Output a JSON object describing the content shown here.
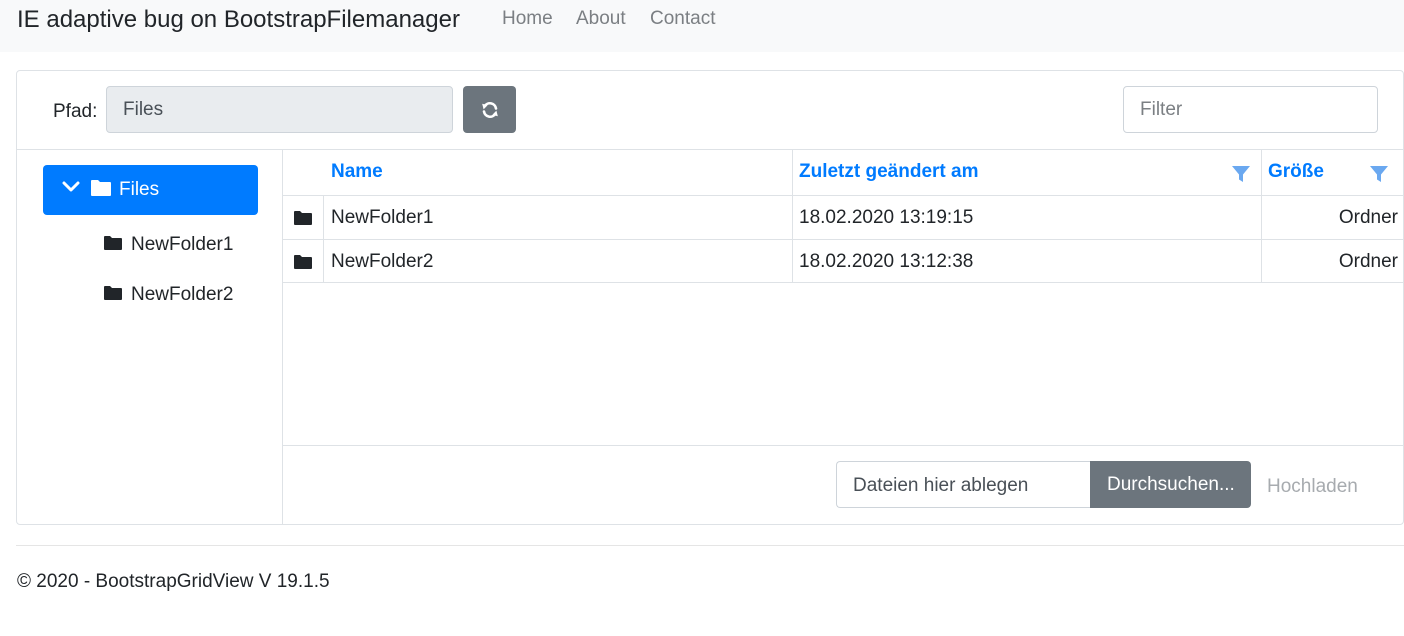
{
  "navbar": {
    "brand": "IE adaptive bug on BootstrapFilemanager",
    "links": [
      "Home",
      "About",
      "Contact"
    ]
  },
  "toolbar": {
    "path_label": "Pfad:",
    "path_value": "Files",
    "refresh_icon": "refresh-icon",
    "filter_placeholder": "Filter"
  },
  "tree": {
    "root": {
      "label": "Files",
      "icon": "folder-open-icon",
      "expanded": true
    },
    "children": [
      {
        "label": "NewFolder1",
        "icon": "folder-icon"
      },
      {
        "label": "NewFolder2",
        "icon": "folder-icon"
      }
    ]
  },
  "grid": {
    "columns": [
      "Name",
      "Zuletzt geändert am",
      "Größe"
    ],
    "rows": [
      {
        "name": "NewFolder1",
        "modified": "18.02.2020 13:19:15",
        "size": "Ordner"
      },
      {
        "name": "NewFolder2",
        "modified": "18.02.2020 13:12:38",
        "size": "Ordner"
      }
    ]
  },
  "upload": {
    "drop_text": "Dateien hier ablegen",
    "browse_label": "Durchsuchen...",
    "upload_label": "Hochladen"
  },
  "footer": {
    "text": "© 2020 - BootstrapGridView V 19.1.5"
  },
  "colors": {
    "primary": "#007bff",
    "secondary": "#6c757d",
    "navbar_bg": "#f8f9fa",
    "filter_icon": "#6aa8f0"
  }
}
